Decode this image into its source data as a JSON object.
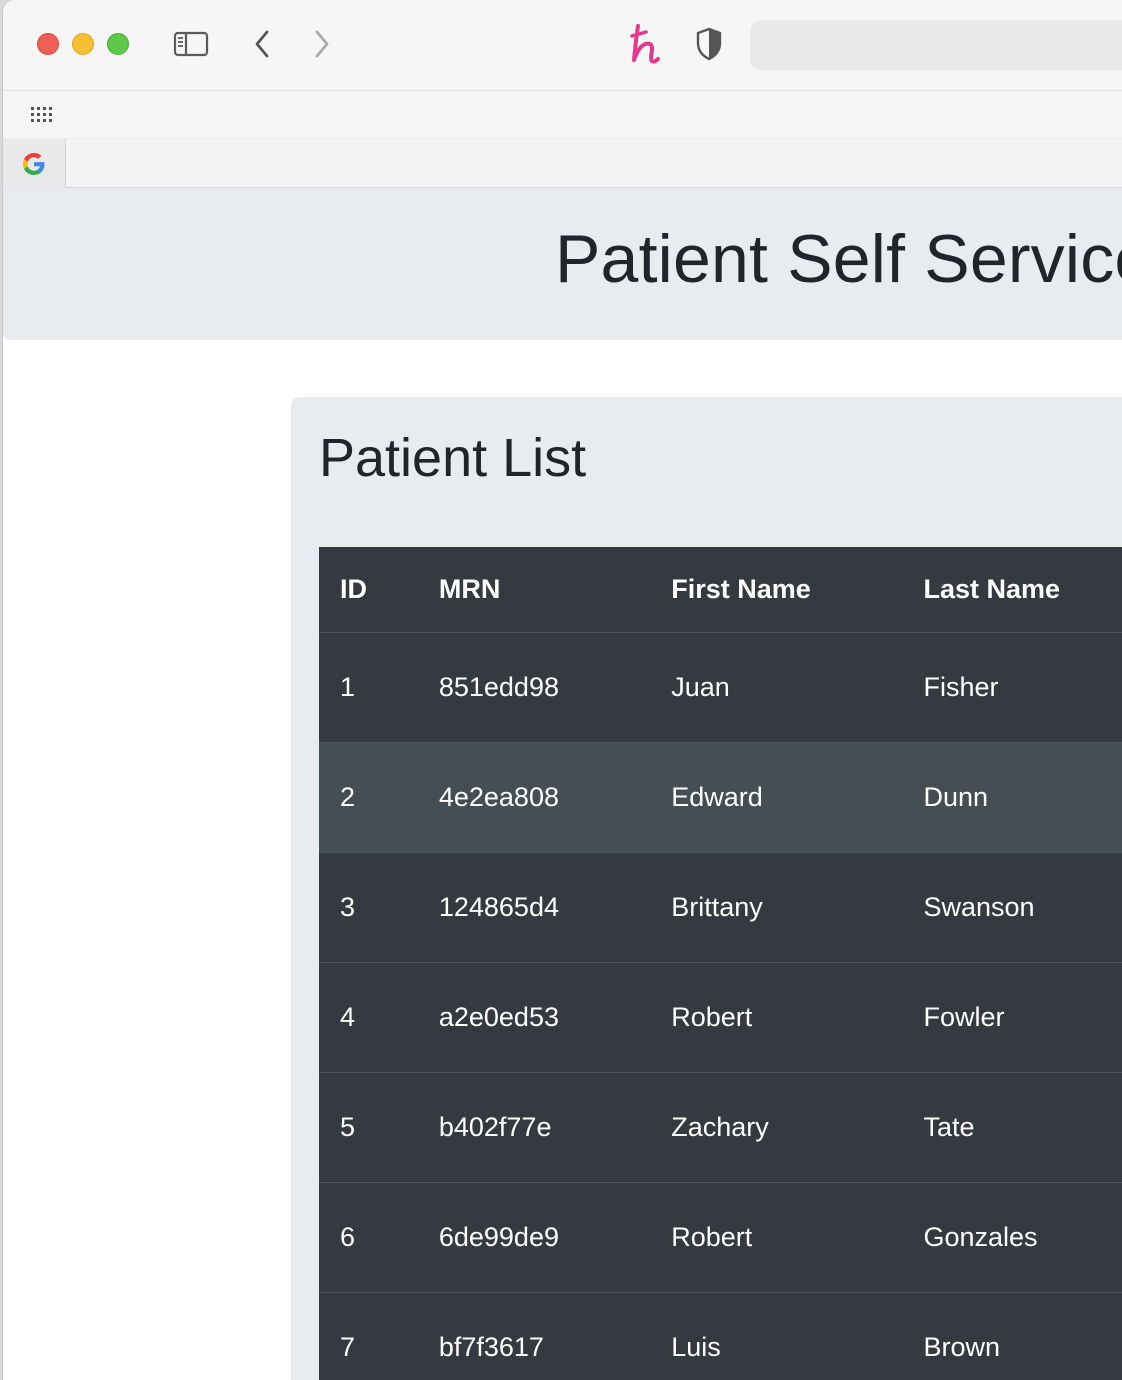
{
  "browser": {
    "window_controls": [
      "close",
      "minimize",
      "maximize"
    ],
    "toolbar": {
      "sidebar_icon": "sidebar-icon",
      "back_icon": "chevron-left-icon",
      "forward_icon": "chevron-right-icon",
      "extensions": [
        {
          "name": "honey-extension-icon",
          "glyph": "h",
          "color": "#e0398f"
        },
        {
          "name": "privacy-shield-icon",
          "color": "#555555"
        }
      ]
    },
    "favorites_bar": {
      "icon": "apps-grid-icon"
    },
    "tabs": [
      {
        "icon": "google-icon",
        "glyph": "G"
      }
    ]
  },
  "page": {
    "site_title": "Patient Self Service",
    "section_title": "Patient List",
    "table": {
      "columns": [
        "ID",
        "MRN",
        "First Name",
        "Last Name"
      ],
      "rows": [
        {
          "id": "1",
          "mrn": "851edd98",
          "first": "Juan",
          "last": "Fisher"
        },
        {
          "id": "2",
          "mrn": "4e2ea808",
          "first": "Edward",
          "last": "Dunn"
        },
        {
          "id": "3",
          "mrn": "124865d4",
          "first": "Brittany",
          "last": "Swanson"
        },
        {
          "id": "4",
          "mrn": "a2e0ed53",
          "first": "Robert",
          "last": "Fowler"
        },
        {
          "id": "5",
          "mrn": "b402f77e",
          "first": "Zachary",
          "last": "Tate"
        },
        {
          "id": "6",
          "mrn": "6de99de9",
          "first": "Robert",
          "last": "Gonzales"
        },
        {
          "id": "7",
          "mrn": "bf7f3617",
          "first": "Luis",
          "last": "Brown"
        }
      ],
      "hovered_row": 2
    }
  },
  "colors": {
    "jumbotron_bg": "#e9ecef",
    "table_dark": "#343a40",
    "table_hover": "#454d55",
    "text_dark": "#212529"
  }
}
